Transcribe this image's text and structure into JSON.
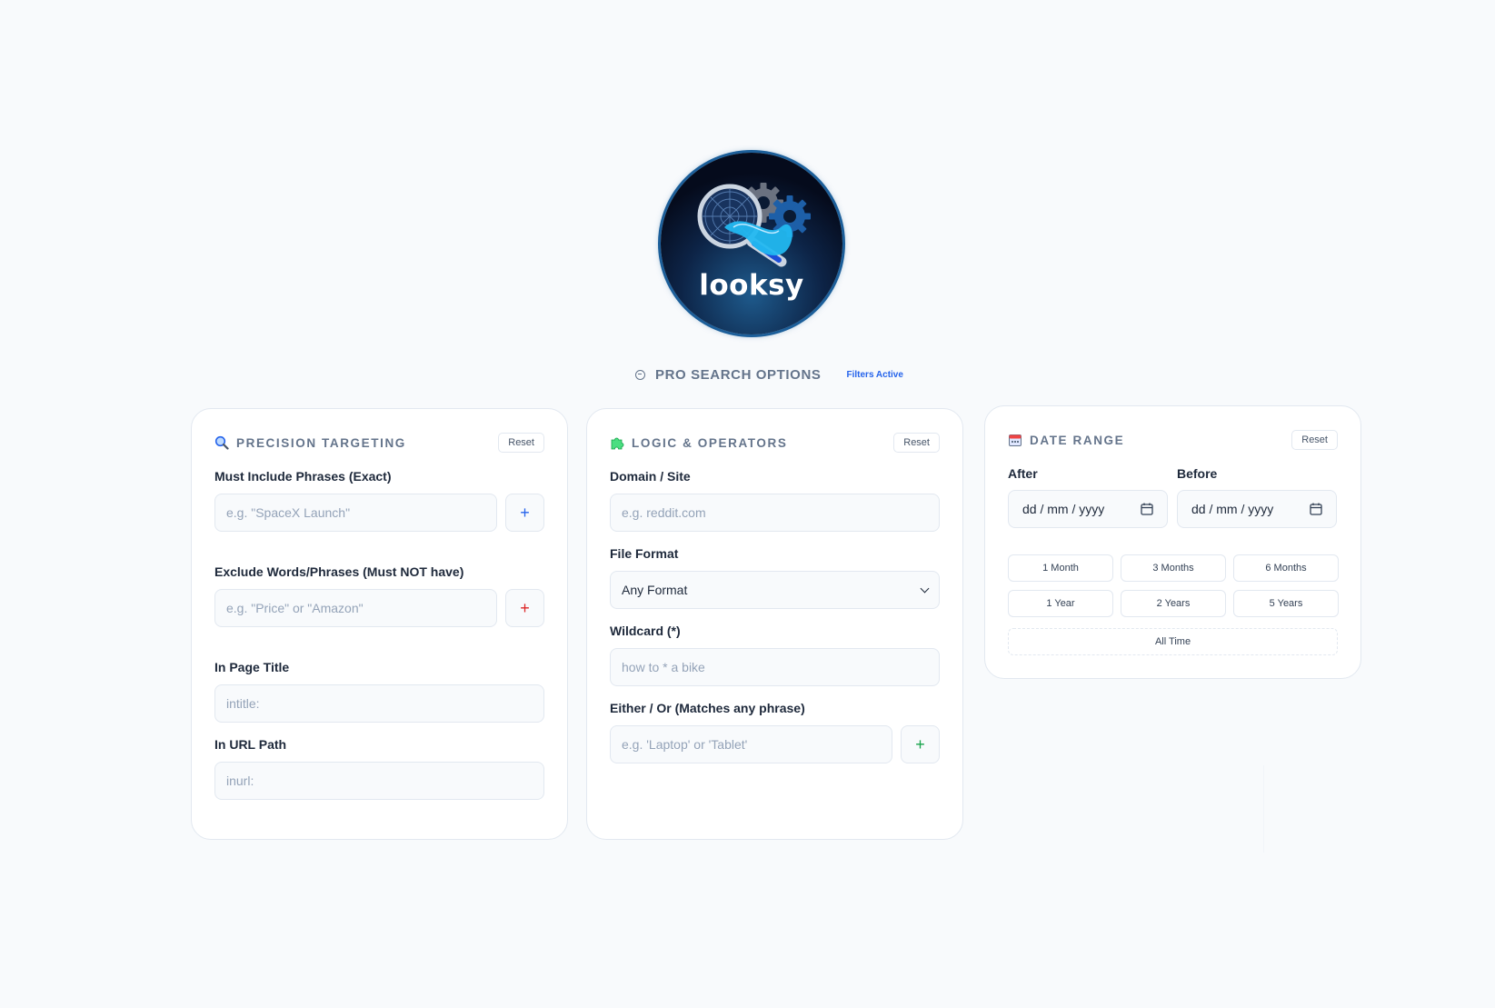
{
  "logo": {
    "text": "looksy"
  },
  "pro_search": {
    "title": "PRO SEARCH OPTIONS",
    "badge": "Filters Active"
  },
  "colors": {
    "accent_blue": "#2563eb",
    "accent_red": "#dc2626",
    "accent_green": "#16a34a",
    "muted": "#64748b"
  },
  "precision": {
    "icon": "magnifier-icon",
    "title": "PRECISION TARGETING",
    "reset": "Reset",
    "include_label": "Must Include Phrases (Exact)",
    "include_placeholder": "e.g. \"SpaceX Launch\"",
    "include_add": "+",
    "exclude_label": "Exclude Words/Phrases (Must NOT have)",
    "exclude_placeholder": "e.g. \"Price\" or \"Amazon\"",
    "exclude_add": "+",
    "title_label": "In Page Title",
    "title_placeholder": "intitle:",
    "url_label": "In URL Path",
    "url_placeholder": "inurl:"
  },
  "logic": {
    "icon": "puzzle-icon",
    "title": "LOGIC & OPERATORS",
    "reset": "Reset",
    "domain_label": "Domain / Site",
    "domain_placeholder": "e.g. reddit.com",
    "format_label": "File Format",
    "format_value": "Any Format",
    "wildcard_label": "Wildcard (*)",
    "wildcard_placeholder": "how to * a bike",
    "either_label": "Either / Or (Matches any phrase)",
    "either_placeholder": "e.g. 'Laptop' or 'Tablet'",
    "either_add": "+"
  },
  "date": {
    "icon": "calendar-icon",
    "title": "DATE RANGE",
    "reset": "Reset",
    "after_label": "After",
    "after_value": "dd / mm / yyyy",
    "before_label": "Before",
    "before_value": "dd / mm / yyyy",
    "ranges": [
      "1 Month",
      "3 Months",
      "6 Months",
      "1 Year",
      "2 Years",
      "5 Years"
    ],
    "all_time": "All Time"
  }
}
